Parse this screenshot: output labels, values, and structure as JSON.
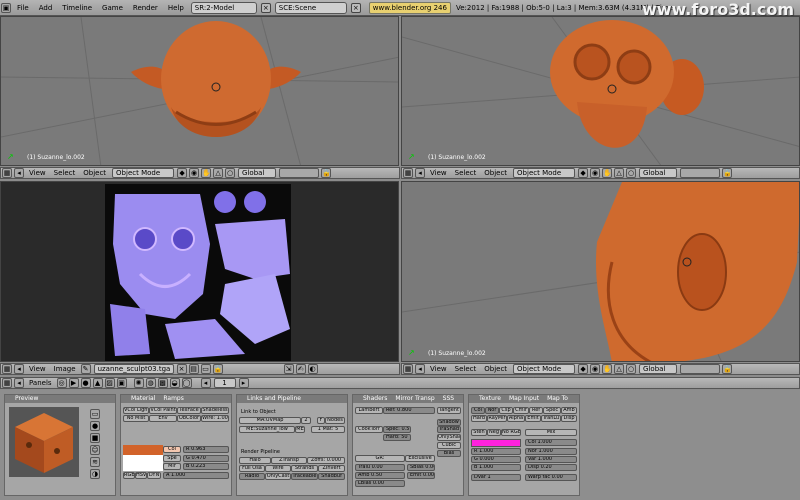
{
  "menu": {
    "items": [
      "File",
      "Add",
      "Timeline",
      "Game",
      "Render",
      "Help"
    ],
    "screen": "SR:2-Model",
    "scene": "SCE:Scene",
    "url": "www.blender.org 246",
    "stats": "Ve:2012 | Fa:1988 | Ob:5-0 | La:3 | Mem:3.63M (4.31M) | Time:",
    "watermark": "www.foro3d.com"
  },
  "viewports": {
    "tl_label": "(1) Suzanne_lo.002",
    "tr_label": "(1) Suzanne_lo.002",
    "br_label": "(1) Suzanne_lo.002"
  },
  "view3d_header": {
    "view": "View",
    "select": "Select",
    "object": "Object",
    "mode": "Object Mode",
    "orient": "Global"
  },
  "image_header": {
    "view": "View",
    "image": "Image",
    "image_name": "uzanne_sculpt03.tga"
  },
  "buttons_header": {
    "panels": "Panels",
    "frame": "1"
  },
  "panels": {
    "preview": "Preview",
    "material": {
      "title": "Material",
      "tab2": "Ramps"
    },
    "links": {
      "title": "Links and Pipeline",
      "link_to": "Link to Object",
      "ma_name": "MA:UVMap",
      "users": "2",
      "f": "F",
      "nodes": "Nodes",
      "me_name": "ME:Suzanne_low",
      "me_btn": "ME",
      "mat_count": "1 Mat: 5",
      "render_pipeline": "Render Pipeline",
      "pipe_row1": [
        "Halo",
        "ZTransp",
        "Zoffs: 0.000"
      ],
      "pipe_row2": [
        "Full Osa",
        "Wire",
        "Strands",
        "ZInvert"
      ],
      "pipe_row3": [
        "Radio",
        "OnlyCast",
        "Traceable",
        "Shadbuf"
      ]
    },
    "material_rows": {
      "row1": [
        "VCol Light",
        "VCol Paint",
        "TexFace",
        "Shadeless"
      ],
      "row2": [
        "No Mist",
        "Env",
        "ObColor",
        "Wire: 1.00"
      ],
      "col": "Col",
      "spe": "Spe",
      "mir": "Mir",
      "r": "R 0.963",
      "g": "G 0.470",
      "b": "B 0.223",
      "rgb": "RGB",
      "hsv": "HSV",
      "dyn": "DYN",
      "alpha": "A 1.000"
    },
    "shaders": {
      "title": "Shaders",
      "tabs": [
        "Mirror Transp",
        "SSS"
      ],
      "lambert": "Lambert",
      "ref": "Ref: 0.800",
      "tangent": "Tangent",
      "cooktorr": "CookTorr",
      "spec": "Spec: 0.5",
      "hard": "Hard: 50",
      "shadow": "Shadow",
      "traceble": "TraShad",
      "onlysha": "OnlyShad",
      "cubic": "Cubic",
      "bias": "Bias",
      "gr": "GR:",
      "exclusive": "Exclusive",
      "tralu": "Tralu 0.00",
      "sbias": "SBias 0.00",
      "amb": "Amb 0.50",
      "emit": "Emit 0.00",
      "lbias": "LBias 0.00"
    },
    "texture": {
      "tabs": [
        "Texture",
        "Map Input",
        "Map To"
      ],
      "row1": [
        "Col",
        "Nor",
        "Csp",
        "Cmir",
        "Ref",
        "Spec",
        "Amb"
      ],
      "row2": [
        "Hard",
        "RayMir",
        "Alpha",
        "Emit",
        "TranLu",
        "Disp"
      ],
      "stencil": "Sten",
      "neg": "Neg",
      "norgb": "No RGB",
      "mix": "Mix",
      "r": "R 1.000",
      "g": "G 0.000",
      "b": "B 1.000",
      "dvar": "DVar 1",
      "col": "Col 1.000",
      "nor": "Nor 1.000",
      "var": "Var 1.000",
      "disp": "Disp 0.20",
      "warp": "Warp fac 0.00"
    }
  },
  "colors": {
    "accent": "#ff22dd",
    "orange": "#d2632a",
    "selected": "#f3c7b0"
  }
}
